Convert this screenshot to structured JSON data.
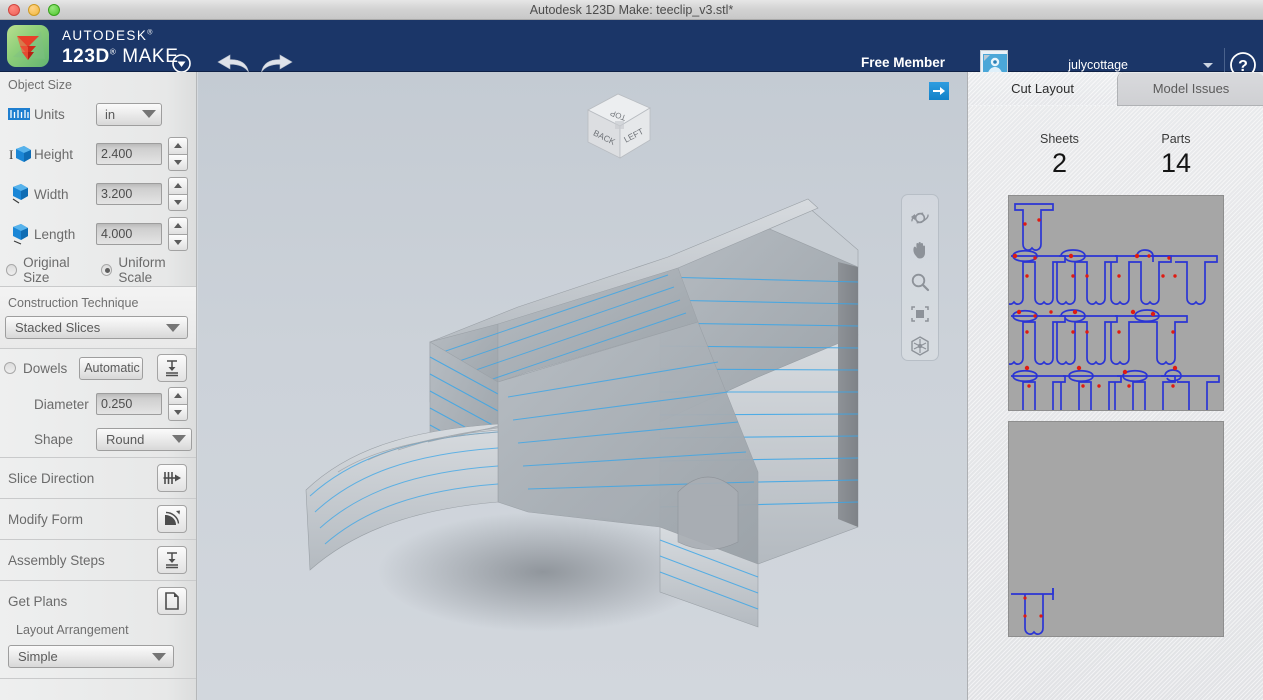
{
  "window": {
    "title": "Autodesk 123D Make: teeclip_v3.stl*",
    "traffic_lights": [
      "close",
      "minimize",
      "zoom"
    ]
  },
  "header": {
    "brand_line1": "AUTODESK",
    "brand_line2_a": "123D",
    "brand_line2_b": "MAKE",
    "membership": "Free Member",
    "username": "julycottage",
    "icons": [
      "app-menu-caret",
      "undo-arrow",
      "redo-arrow",
      "user-caret",
      "help-question"
    ],
    "accent_navy": "#1b3668"
  },
  "sidebar": {
    "object_size": {
      "title": "Object Size",
      "units_label": "Units",
      "units_value": "in",
      "fields": [
        {
          "label": "Height",
          "value": "2.400",
          "icon": "height-cube-icon"
        },
        {
          "label": "Width",
          "value": "3.200",
          "icon": "width-cube-icon"
        },
        {
          "label": "Length",
          "value": "4.000",
          "icon": "length-cube-icon"
        }
      ],
      "scale_modes": [
        {
          "label": "Original Size",
          "selected": false
        },
        {
          "label": "Uniform Scale",
          "selected": true
        }
      ]
    },
    "construction": {
      "title": "Construction Technique",
      "value": "Stacked Slices"
    },
    "dowels": {
      "label": "Dowels",
      "enabled": false,
      "mode_button": "Automatic",
      "diameter_label": "Diameter",
      "diameter_value": "0.250",
      "shape_label": "Shape",
      "shape_value": "Round"
    },
    "tools": [
      {
        "label": "Slice Direction",
        "icon": "slice-direction-icon"
      },
      {
        "label": "Modify Form",
        "icon": "modify-form-icon"
      },
      {
        "label": "Assembly Steps",
        "icon": "assembly-steps-icon"
      },
      {
        "label": "Get Plans",
        "icon": "get-plans-icon"
      }
    ],
    "layout": {
      "title": "Layout Arrangement",
      "value": "Simple"
    }
  },
  "viewport": {
    "view_cube": {
      "top": "TOP",
      "front": "BACK",
      "right": "LEFT"
    },
    "nav_tools": [
      "orbit-icon",
      "pan-icon",
      "zoom-icon",
      "fit-icon",
      "view-cube-icon"
    ],
    "expand_button": "expand-arrow-icon",
    "model_name": "stacked-slices-tee-clip"
  },
  "right_panel": {
    "tabs": [
      {
        "label": "Cut Layout",
        "active": true
      },
      {
        "label": "Model Issues",
        "active": false
      }
    ],
    "stats": [
      {
        "key": "Sheets",
        "value": "2"
      },
      {
        "key": "Parts",
        "value": "14"
      }
    ],
    "sheets": [
      {
        "number": "1",
        "label_visible": false,
        "parts_on_sheet": 13
      },
      {
        "number": "2",
        "label_visible": true,
        "parts_on_sheet": 1
      }
    ],
    "outline_color": "#2b35d4",
    "marker_color": "#e01b12",
    "sheet_bg": "#a4a4a4"
  }
}
